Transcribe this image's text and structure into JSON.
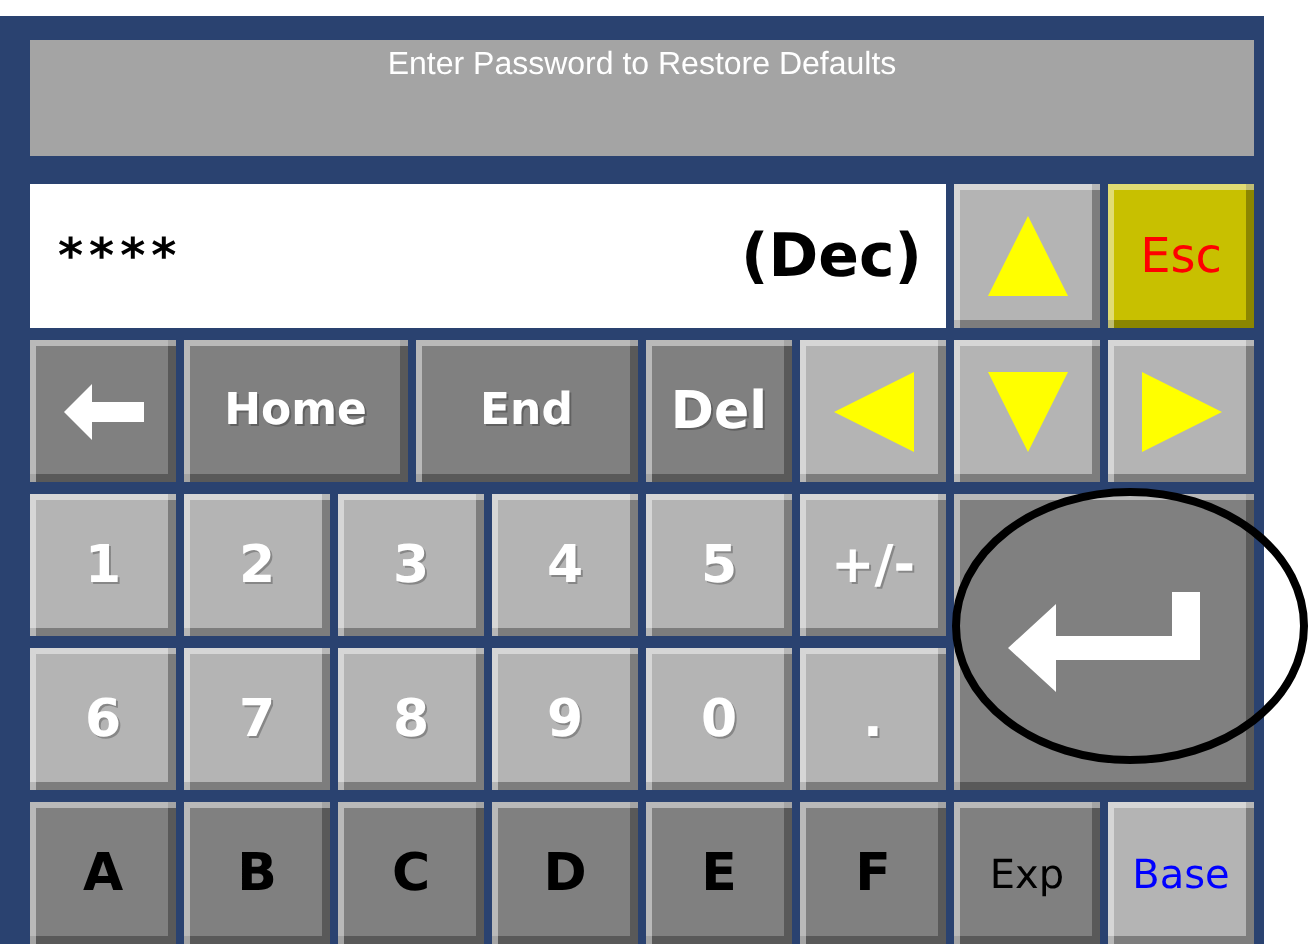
{
  "title": "Enter Password to Restore Defaults",
  "display": {
    "value": "****",
    "base": "(Dec)"
  },
  "keys": [
    {
      "kind": "up"
    },
    {
      "kind": "escape",
      "label": "Esc"
    },
    {
      "kind": "backspace"
    },
    {
      "kind": "wide",
      "label": "Home"
    },
    {
      "kind": "wide",
      "label": "End"
    },
    {
      "kind": "command",
      "label": "Del"
    },
    {
      "kind": "left"
    },
    {
      "kind": "down"
    },
    {
      "kind": "right"
    },
    {
      "kind": "digit",
      "label": "1"
    },
    {
      "kind": "digit",
      "label": "2"
    },
    {
      "kind": "digit",
      "label": "3"
    },
    {
      "kind": "digit",
      "label": "4"
    },
    {
      "kind": "digit",
      "label": "5"
    },
    {
      "kind": "digit",
      "label": "+/-"
    },
    {
      "kind": "enter"
    },
    {
      "kind": "digit",
      "label": "6"
    },
    {
      "kind": "digit",
      "label": "7"
    },
    {
      "kind": "digit",
      "label": "8"
    },
    {
      "kind": "digit",
      "label": "9"
    },
    {
      "kind": "digit",
      "label": "0"
    },
    {
      "kind": "digit",
      "label": "."
    },
    {
      "kind": "letter",
      "label": "A"
    },
    {
      "kind": "letter",
      "label": "B"
    },
    {
      "kind": "letter",
      "label": "C"
    },
    {
      "kind": "letter",
      "label": "D"
    },
    {
      "kind": "letter",
      "label": "E"
    },
    {
      "kind": "letter",
      "label": "F"
    },
    {
      "kind": "option",
      "label": "Exp"
    },
    {
      "kind": "radix",
      "label": "Base"
    }
  ],
  "highlight": {
    "kind": "ellipse"
  }
}
